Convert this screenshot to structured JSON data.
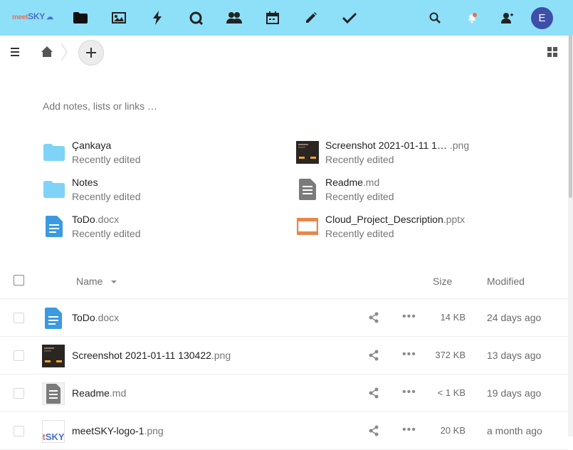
{
  "brand": {
    "part1": "meet",
    "part2": "SKY"
  },
  "user": {
    "avatar_letter": "E"
  },
  "notes": {
    "placeholder": "Add notes, lists or links …"
  },
  "icons": {
    "nav": [
      "folder-icon",
      "image-icon",
      "activity-icon",
      "talk-icon",
      "contacts-icon",
      "calendar-icon",
      "notes-pencil-icon",
      "tasks-check-icon"
    ],
    "right": [
      "search-icon",
      "notifications-icon",
      "contacts-menu-icon"
    ]
  },
  "recent": [
    {
      "name": "Çankaya",
      "ext": "",
      "sub": "Recently edited",
      "icon": "folder-icon"
    },
    {
      "name": "Notes",
      "ext": "",
      "sub": "Recently edited",
      "icon": "folder-icon"
    },
    {
      "name": "ToDo",
      "ext": ".docx",
      "sub": "Recently edited",
      "icon": "document-icon"
    },
    {
      "name": "Screenshot 2021-01-11 1…",
      "ext": " .png",
      "sub": "Recently edited",
      "icon": "image-thumbnail-icon"
    },
    {
      "name": "Readme",
      "ext": ".md",
      "sub": "Recently edited",
      "icon": "text-file-icon"
    },
    {
      "name": "Cloud_Project_Description",
      "ext": ".pptx",
      "sub": "Recently edited",
      "icon": "presentation-icon"
    }
  ],
  "table": {
    "headers": {
      "name": "Name",
      "size": "Size",
      "modified": "Modified"
    },
    "rows": [
      {
        "name": "ToDo",
        "ext": ".docx",
        "size": "14 KB",
        "modified": "24 days ago"
      },
      {
        "name": "Screenshot 2021-01-11 130422",
        "ext": ".png",
        "size": "372 KB",
        "modified": "13 days ago"
      },
      {
        "name": "Readme",
        "ext": ".md",
        "size": "< 1 KB",
        "modified": "19 days ago"
      },
      {
        "name": "meetSKY-logo-1",
        "ext": ".png",
        "size": "20 KB",
        "modified": "a month ago"
      }
    ],
    "more_label": "•••"
  },
  "colors": {
    "topbar": "#8ee0f9",
    "folder": "#7fd3f7",
    "doc": "#3b9ae1",
    "avatar": "#3d4fa8",
    "pptx": "#e8874a"
  }
}
